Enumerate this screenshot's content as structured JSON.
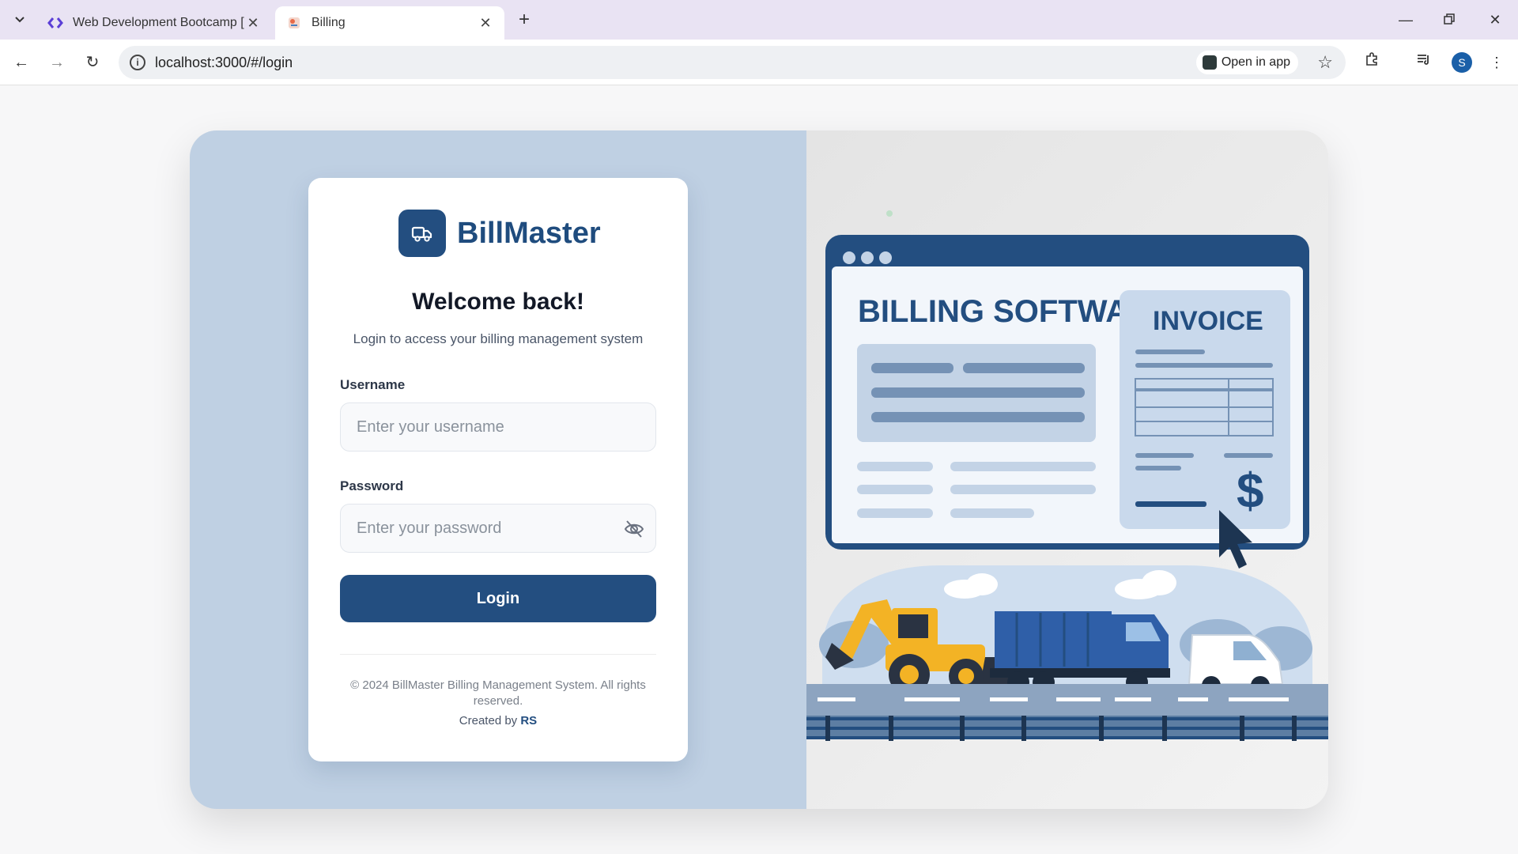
{
  "browser": {
    "tabs": [
      {
        "title": "Web Development Bootcamp [I",
        "active": false
      },
      {
        "title": "Billing",
        "active": true
      }
    ],
    "url": "localhost:3000/#/login",
    "open_in_app": "Open in app",
    "profile_initial": "S"
  },
  "login": {
    "brand": "BillMaster",
    "welcome": "Welcome back!",
    "subtitle": "Login to access your billing management system",
    "username_label": "Username",
    "username_placeholder": "Enter your username",
    "password_label": "Password",
    "password_placeholder": "Enter your password",
    "login_button": "Login",
    "copyright": "© 2024 BillMaster Billing Management System. All rights reserved.",
    "created_prefix": "Created by",
    "created_name": "RS"
  },
  "illustration": {
    "heading": "BILLING SOFTWARE",
    "invoice": "INVOICE",
    "currency": "$"
  },
  "colors": {
    "primary": "#234e80",
    "left_panel": "#bfd0e3",
    "accent_yellow": "#f3b325"
  }
}
